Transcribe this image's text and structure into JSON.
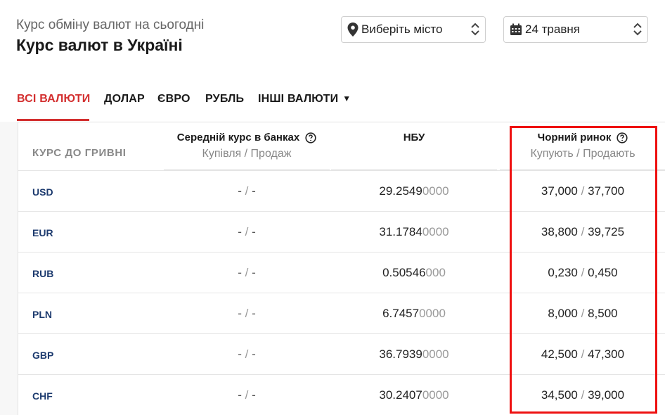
{
  "header": {
    "subtitle": "Курс обміну валют на сьогодні",
    "title": "Курс валют в Україні"
  },
  "filters": {
    "city": {
      "value": "Виберіть місто",
      "icon": "map-pin-icon"
    },
    "date": {
      "value": "24 травня",
      "icon": "calendar-icon"
    }
  },
  "tabs": [
    {
      "label": "ВСІ ВАЛЮТИ",
      "active": true
    },
    {
      "label": "ДОЛАР",
      "active": false
    },
    {
      "label": "ЄВРО",
      "active": false
    },
    {
      "label": "РУБЛЬ",
      "active": false
    },
    {
      "label": "ІНШІ ВАЛЮТИ",
      "active": false
    }
  ],
  "table": {
    "first_header": "КУРС ДО ГРИВНІ",
    "columns": [
      {
        "title": "Середній курс в банках",
        "sub": "Купівля / Продаж"
      },
      {
        "title": "НБУ",
        "sub": ""
      },
      {
        "title": "Чорний ринок",
        "sub": "Купують / Продають"
      }
    ],
    "rows": [
      {
        "currency": "USD",
        "bank_buy": "-",
        "bank_sell": "-",
        "nbu_main": "29.2549",
        "nbu_tail": "0000",
        "black_buy": "37,000",
        "black_sell": "37,700"
      },
      {
        "currency": "EUR",
        "bank_buy": "-",
        "bank_sell": "-",
        "nbu_main": "31.1784",
        "nbu_tail": "0000",
        "black_buy": "38,800",
        "black_sell": "39,725"
      },
      {
        "currency": "RUB",
        "bank_buy": "-",
        "bank_sell": "-",
        "nbu_main": "0.50546",
        "nbu_tail": "000",
        "black_buy": "0,230",
        "black_sell": "0,450"
      },
      {
        "currency": "PLN",
        "bank_buy": "-",
        "bank_sell": "-",
        "nbu_main": "6.7457",
        "nbu_tail": "0000",
        "black_buy": "8,000",
        "black_sell": "8,500"
      },
      {
        "currency": "GBP",
        "bank_buy": "-",
        "bank_sell": "-",
        "nbu_main": "36.7939",
        "nbu_tail": "0000",
        "black_buy": "42,500",
        "black_sell": "47,300"
      },
      {
        "currency": "CHF",
        "bank_buy": "-",
        "bank_sell": "-",
        "nbu_main": "30.2407",
        "nbu_tail": "0000",
        "black_buy": "34,500",
        "black_sell": "39,000"
      }
    ]
  },
  "colors": {
    "accent": "#d32f2f",
    "highlight": "#ee1111",
    "currency": "#1c3a6e"
  }
}
